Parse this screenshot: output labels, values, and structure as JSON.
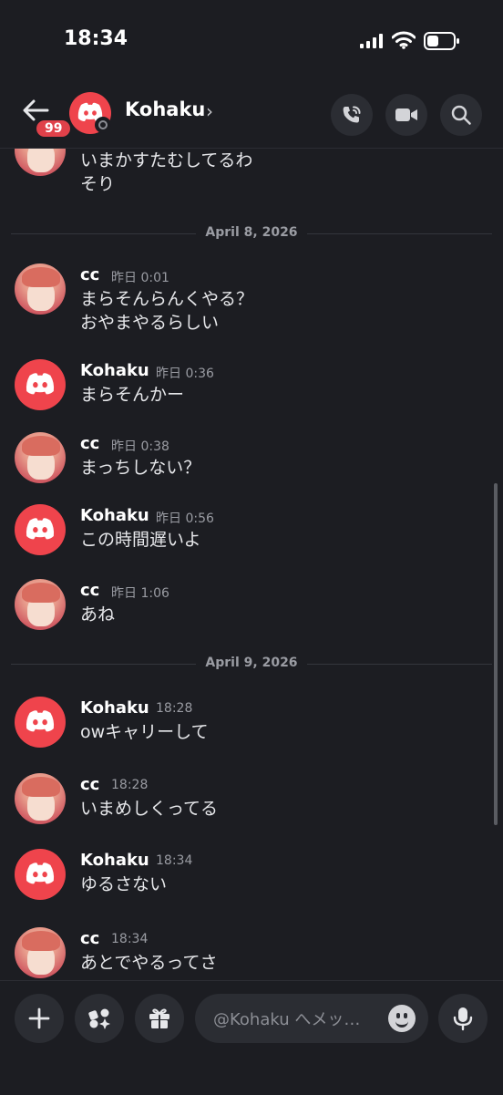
{
  "status_bar": {
    "time": "18:34"
  },
  "header": {
    "unread_badge": "99",
    "name": "Kohaku",
    "chevron": "›"
  },
  "chat": {
    "partial_message": {
      "lines": [
        "いまかすたむしてるわ",
        "そり"
      ]
    },
    "date_separators": [
      "April 8, 2026",
      "April 9, 2026"
    ],
    "messages": [
      {
        "author": "cc",
        "time": "昨日 0:01",
        "lines": [
          "まらそんらんくやる？",
          "おやまやるらしい"
        ]
      },
      {
        "author": "Kohaku",
        "time": "昨日 0:36",
        "lines": [
          "まらそんかー"
        ]
      },
      {
        "author": "cc",
        "time": "昨日 0:38",
        "lines": [
          "まっちしない？"
        ]
      },
      {
        "author": "Kohaku",
        "time": "昨日 0:56",
        "lines": [
          "この時間遅いよ"
        ]
      },
      {
        "author": "cc",
        "time": "昨日 1:06",
        "lines": [
          "あね"
        ]
      },
      {
        "author": "Kohaku",
        "time": "18:28",
        "lines": [
          "owキャリーして"
        ]
      },
      {
        "author": "cc",
        "time": "18:28",
        "lines": [
          "いまめしくってる"
        ]
      },
      {
        "author": "Kohaku",
        "time": "18:34",
        "lines": [
          "ゆるさない"
        ]
      },
      {
        "author": "cc",
        "time": "18:34",
        "lines": [
          "あとでやるってさ"
        ]
      }
    ]
  },
  "composer": {
    "placeholder": "@Kohaku へメッ…"
  },
  "icons": {
    "header": [
      "back-arrow-icon",
      "discord-logo-icon",
      "phone-call-icon",
      "video-camera-icon",
      "search-icon"
    ],
    "composer": [
      "plus-icon",
      "apps-icon",
      "gift-icon",
      "emoji-icon",
      "microphone-icon"
    ]
  },
  "colors": {
    "background": "#1c1d22",
    "accent_red": "#ef444c",
    "badge_red": "#e0414a",
    "muted_text": "#9a9ca3"
  }
}
